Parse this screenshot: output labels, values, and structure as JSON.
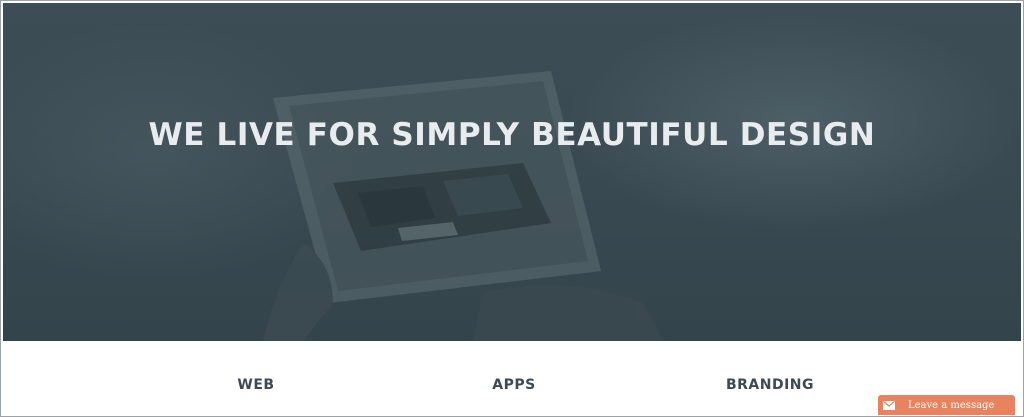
{
  "hero": {
    "title": "WE LIVE FOR SIMPLY BEAUTIFUL DESIGN"
  },
  "services": {
    "items": [
      {
        "label": "WEB"
      },
      {
        "label": "APPS"
      },
      {
        "label": "BRANDING"
      }
    ]
  },
  "chat_widget": {
    "label": "Leave a message",
    "icon": "envelope-icon",
    "color": "#e8825f"
  },
  "colors": {
    "hero_overlay": "#3c4d55",
    "service_text": "#3d4a52"
  }
}
